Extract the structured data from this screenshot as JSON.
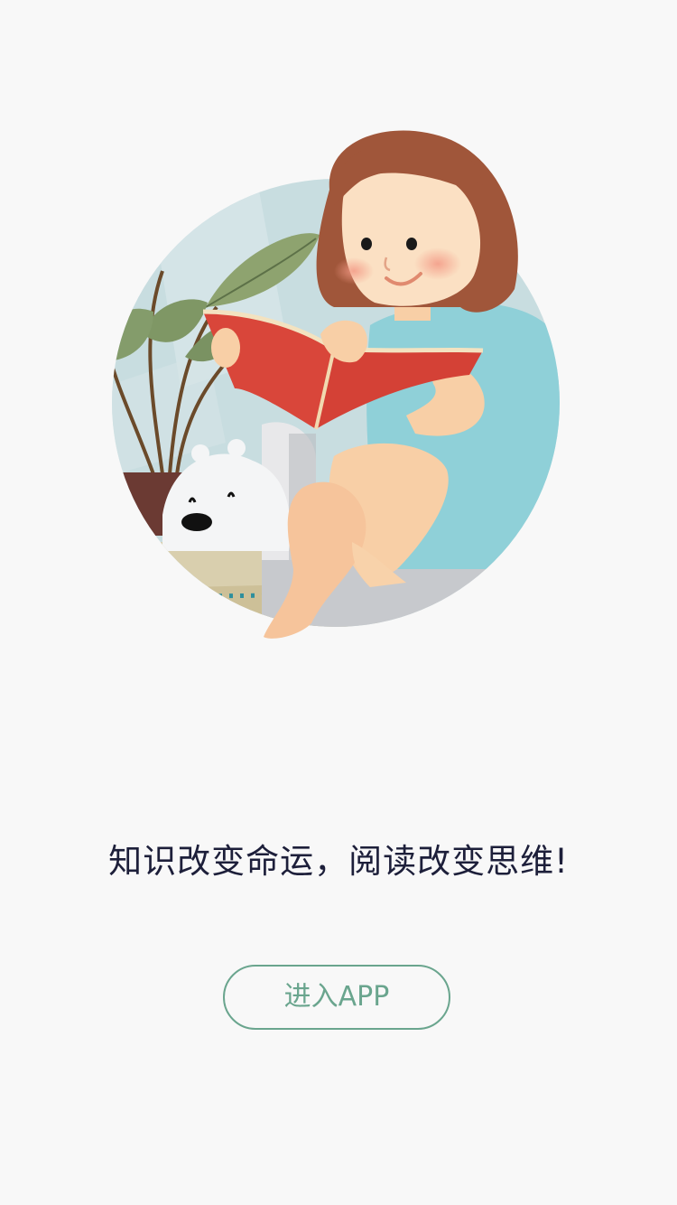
{
  "hero": {
    "illustration": "girl-reading-book-illustration"
  },
  "slogan": "知识改变命运，阅读改变思维!",
  "enter_button": {
    "label": "进入APP"
  },
  "colors": {
    "background": "#f8f8f8",
    "slogan_text": "#1d1f3a",
    "button_accent": "#6aa58e"
  }
}
